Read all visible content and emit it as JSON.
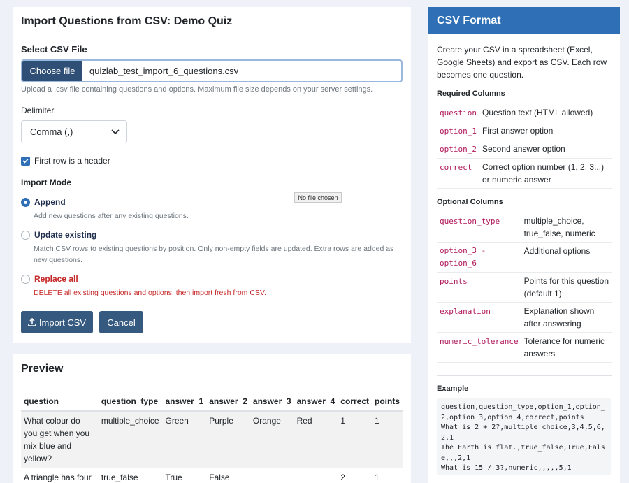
{
  "import_form": {
    "title": "Import Questions from CSV: Demo Quiz",
    "file_label": "Select CSV File",
    "choose_file_label": "Choose file",
    "file_name": "quizlab_test_import_6_questions.csv",
    "file_help": "Upload a .csv file containing questions and options. Maximum file size depends on your server settings.",
    "delimiter_label": "Delimiter",
    "delimiter_value": "Comma (,)",
    "header_checkbox_label": "First row is a header",
    "header_checked": true,
    "mode_label": "Import Mode",
    "modes": [
      {
        "label": "Append",
        "help": "Add new questions after any existing questions.",
        "selected": true
      },
      {
        "label": "Update existing",
        "help": "Match CSV rows to existing questions by position. Only non-empty fields are updated. Extra rows are added as new questions.",
        "selected": false
      },
      {
        "label": "Replace all",
        "help": "DELETE all existing questions and options, then import fresh from CSV.",
        "selected": false
      }
    ],
    "tooltip": "No file chosen",
    "import_button": "Import CSV",
    "cancel_button": "Cancel"
  },
  "preview": {
    "title": "Preview",
    "columns": [
      "question",
      "question_type",
      "answer_1",
      "answer_2",
      "answer_3",
      "answer_4",
      "correct",
      "points"
    ],
    "rows": [
      [
        "What colour do you get when you mix blue and yellow?",
        "multiple_choice",
        "Green",
        "Purple",
        "Orange",
        "Red",
        "1",
        "1"
      ],
      [
        "A triangle has four sides.",
        "true_false",
        "True",
        "False",
        "",
        "",
        "2",
        "1"
      ]
    ]
  },
  "csv_format": {
    "title": "CSV Format",
    "intro": "Create your CSV in a spreadsheet (Excel, Google Sheets) and export as CSV. Each row becomes one question.",
    "required_label": "Required Columns",
    "required": [
      {
        "name": "question",
        "desc": "Question text (HTML allowed)"
      },
      {
        "name": "option_1",
        "desc": "First answer option"
      },
      {
        "name": "option_2",
        "desc": "Second answer option"
      },
      {
        "name": "correct",
        "desc": "Correct option number (1, 2, 3...) or numeric answer"
      }
    ],
    "optional_label": "Optional Columns",
    "optional": [
      {
        "name": "question_type",
        "desc": "multiple_choice, true_false, numeric"
      },
      {
        "name": "option_3 - option_6",
        "desc": "Additional options"
      },
      {
        "name": "points",
        "desc": "Points for this question (default 1)"
      },
      {
        "name": "explanation",
        "desc": "Explanation shown after answering"
      },
      {
        "name": "numeric_tolerance",
        "desc": "Tolerance for numeric answers"
      }
    ],
    "example_label": "Example",
    "example_text": "question,question_type,option_1,option_2,option_3,option_4,correct,points\nWhat is 2 + 2?,multiple_choice,3,4,5,6,2,1\nThe Earth is flat.,true_false,True,False,,,2,1\nWhat is 15 / 3?,numeric,,,,,5,1"
  },
  "colors": {
    "accent": "#2f6fb5",
    "button": "#35597f",
    "danger": "#c62828",
    "code": "#b0195b"
  }
}
